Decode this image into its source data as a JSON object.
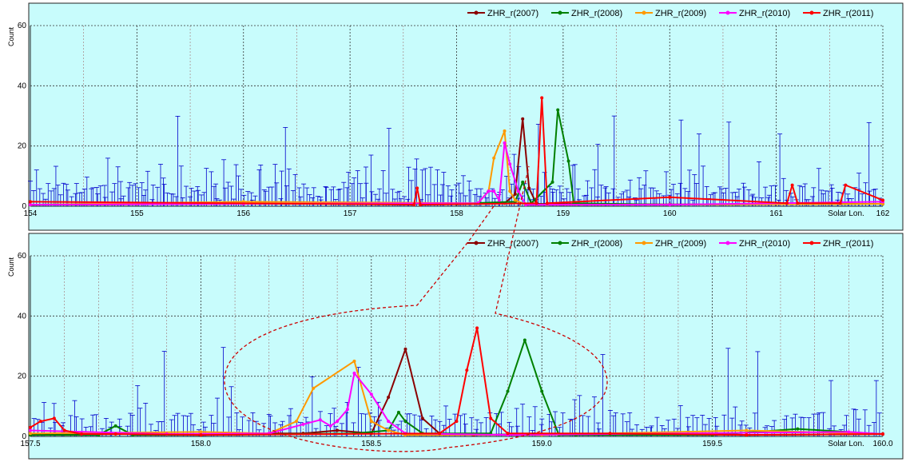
{
  "colors": {
    "background": "#c8fcfc",
    "frame": "#222222",
    "grid": "#a07070",
    "errorbar": "#0000cc",
    "zoom_callout": "#cc0000"
  },
  "chart_data": [
    {
      "type": "line",
      "ylabel": "Count",
      "xlabel": "Solar Lon.",
      "xlim": [
        154,
        162
      ],
      "ylim": [
        0,
        60
      ],
      "xticks": [
        "154",
        "155",
        "156",
        "157",
        "158",
        "159",
        "160",
        "161",
        "162"
      ],
      "yticks": [
        "0",
        "20",
        "40",
        "60"
      ],
      "grid": true,
      "legend": "top-right",
      "series": [
        {
          "name": "ZHR_r(2007)",
          "color": "#8b0000",
          "x": [
            154.0,
            156.0,
            158.0,
            158.45,
            158.55,
            158.62,
            158.68,
            158.75,
            160.0,
            162.0
          ],
          "y": [
            0.5,
            0.8,
            0.8,
            1.0,
            4.0,
            29.0,
            6.0,
            0.8,
            0.6,
            0.8
          ]
        },
        {
          "name": "ZHR_r(2008)",
          "color": "#008000",
          "x": [
            154.0,
            155.0,
            156.0,
            158.0,
            158.55,
            158.62,
            158.7,
            158.9,
            158.95,
            159.05,
            159.1,
            160.0,
            162.0
          ],
          "y": [
            0.5,
            1.0,
            0.8,
            0.8,
            1.5,
            8.0,
            1.0,
            8.0,
            32.0,
            15.0,
            1.0,
            0.5,
            0.8
          ]
        },
        {
          "name": "ZHR_r(2009)",
          "color": "#ff9900",
          "x": [
            154.0,
            156.0,
            158.2,
            158.3,
            158.35,
            158.45,
            158.5,
            158.55,
            158.65,
            160.0,
            162.0
          ],
          "y": [
            0.5,
            1.5,
            1.0,
            5.0,
            16.0,
            25.0,
            5.0,
            2.0,
            0.5,
            0.5,
            0.8
          ]
        },
        {
          "name": "ZHR_r(2010)",
          "color": "#ff00ff",
          "x": [
            154.0,
            156.0,
            158.2,
            158.3,
            158.35,
            158.4,
            158.45,
            158.5,
            158.58,
            158.65,
            160.0,
            162.0
          ],
          "y": [
            0.5,
            0.8,
            1.0,
            5.0,
            5.0,
            2.0,
            21.0,
            14.0,
            5.0,
            0.5,
            0.5,
            1.5
          ]
        },
        {
          "name": "ZHR_r(2011)",
          "color": "#ff0000",
          "x": [
            154.0,
            157.6,
            157.63,
            157.66,
            158.75,
            158.8,
            158.85,
            160.0,
            161.1,
            161.15,
            161.2,
            161.6,
            161.65,
            162.0
          ],
          "y": [
            1.5,
            0.5,
            6.0,
            0.5,
            1.0,
            36.0,
            1.0,
            3.0,
            1.0,
            7.0,
            1.0,
            1.0,
            7.0,
            2.0
          ]
        }
      ]
    },
    {
      "type": "line",
      "ylabel": "Count",
      "xlabel": "Solar Lon.",
      "xlim": [
        157.5,
        160.0
      ],
      "ylim": [
        0,
        60
      ],
      "xticks": [
        "157.5",
        "158.0",
        "158.5",
        "159.0",
        "159.5",
        "160.0"
      ],
      "yticks": [
        "0",
        "20",
        "40",
        "60"
      ],
      "grid": true,
      "legend": "top-right",
      "series": [
        {
          "name": "ZHR_r(2007)",
          "color": "#8b0000",
          "x": [
            157.5,
            157.8,
            158.0,
            158.2,
            158.3,
            158.4,
            158.5,
            158.55,
            158.6,
            158.65,
            158.7,
            158.8,
            159.0,
            159.3,
            159.6,
            160.0
          ],
          "y": [
            0.5,
            0.8,
            0.5,
            1.0,
            1.0,
            2.0,
            1.0,
            13.0,
            29.0,
            6.0,
            1.0,
            0.5,
            0.8,
            0.8,
            0.5,
            0.8
          ]
        },
        {
          "name": "ZHR_r(2008)",
          "color": "#008000",
          "x": [
            157.5,
            157.7,
            157.75,
            157.8,
            158.0,
            158.45,
            158.55,
            158.58,
            158.6,
            158.65,
            158.85,
            158.9,
            158.95,
            159.0,
            159.05,
            159.1,
            159.5,
            159.75,
            160.0
          ],
          "y": [
            0.5,
            0.5,
            3.5,
            0.5,
            0.5,
            1.0,
            2.0,
            8.0,
            5.0,
            1.0,
            1.0,
            15.0,
            32.0,
            15.0,
            0.5,
            0.5,
            0.5,
            2.5,
            0.8
          ]
        },
        {
          "name": "ZHR_r(2009)",
          "color": "#ff9900",
          "x": [
            157.5,
            158.0,
            158.2,
            158.28,
            158.33,
            158.45,
            158.5,
            158.55,
            158.6,
            159.0,
            159.6,
            160.0
          ],
          "y": [
            1.0,
            1.5,
            1.0,
            5.0,
            16.0,
            25.0,
            5.0,
            2.0,
            0.5,
            0.5,
            2.0,
            0.8
          ]
        },
        {
          "name": "ZHR_r(2010)",
          "color": "#ff00ff",
          "x": [
            157.5,
            157.9,
            158.2,
            158.3,
            158.35,
            158.38,
            158.4,
            158.43,
            158.45,
            158.5,
            158.55,
            158.6,
            158.9,
            159.9,
            160.0
          ],
          "y": [
            2.0,
            0.8,
            1.0,
            4.0,
            5.5,
            3.5,
            5.0,
            9.0,
            21.0,
            14.0,
            5.0,
            1.0,
            0.5,
            1.5,
            0.8
          ]
        },
        {
          "name": "ZHR_r(2011)",
          "color": "#ff0000",
          "x": [
            157.5,
            157.53,
            157.57,
            157.6,
            157.65,
            157.75,
            158.0,
            158.7,
            158.75,
            158.78,
            158.81,
            158.85,
            158.9,
            159.2,
            159.6,
            160.0
          ],
          "y": [
            3.0,
            5.0,
            6.0,
            2.0,
            0.8,
            0.8,
            0.5,
            1.0,
            5.0,
            22.0,
            36.0,
            6.0,
            1.0,
            1.0,
            0.5,
            0.8
          ]
        }
      ]
    }
  ]
}
